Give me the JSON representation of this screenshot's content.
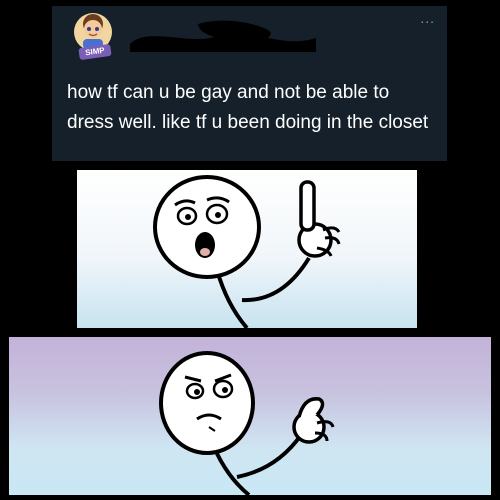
{
  "tweet": {
    "avatar_badge": "SIMP",
    "more_glyph": "...",
    "text": "how tf can u be gay and not be able to dress well. like tf u been doing in the closet"
  },
  "panels": [
    {
      "icon": "stickman-pointing-surprised-icon"
    },
    {
      "icon": "stickman-pointing-thinking-icon"
    }
  ]
}
